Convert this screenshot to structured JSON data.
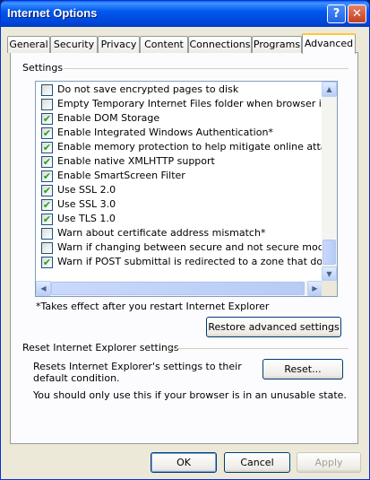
{
  "window": {
    "title": "Internet Options"
  },
  "titlebar_buttons": {
    "help": "?",
    "close": "✕"
  },
  "tabs": [
    {
      "label": "General"
    },
    {
      "label": "Security"
    },
    {
      "label": "Privacy"
    },
    {
      "label": "Content"
    },
    {
      "label": "Connections"
    },
    {
      "label": "Programs"
    },
    {
      "label": "Advanced",
      "active": true
    }
  ],
  "settings_group": {
    "label": "Settings"
  },
  "settings_items": [
    {
      "label": "Do not save encrypted pages to disk",
      "checked": false
    },
    {
      "label": "Empty Temporary Internet Files folder when browser is clo",
      "checked": false
    },
    {
      "label": "Enable DOM Storage",
      "checked": true
    },
    {
      "label": "Enable Integrated Windows Authentication*",
      "checked": true
    },
    {
      "label": "Enable memory protection to help mitigate online attacks*",
      "checked": true
    },
    {
      "label": "Enable native XMLHTTP support",
      "checked": true
    },
    {
      "label": "Enable SmartScreen Filter",
      "checked": true
    },
    {
      "label": "Use SSL 2.0",
      "checked": true
    },
    {
      "label": "Use SSL 3.0",
      "checked": true
    },
    {
      "label": "Use TLS 1.0",
      "checked": true
    },
    {
      "label": "Warn about certificate address mismatch*",
      "checked": false
    },
    {
      "label": "Warn if changing between secure and not secure mode",
      "checked": false
    },
    {
      "label": "Warn if POST submittal is redirected to a zone that does n",
      "checked": true
    }
  ],
  "restart_note": "*Takes effect after you restart Internet Explorer",
  "restore_button": "Restore advanced settings",
  "reset_group": {
    "label": "Reset Internet Explorer settings",
    "description": "Resets Internet Explorer's settings to their default condition.",
    "reset_button": "Reset...",
    "warning": "You should only use this if your browser is in an unusable state."
  },
  "footer": {
    "ok": "OK",
    "cancel": "Cancel",
    "apply": "Apply"
  },
  "check_glyph": "✔"
}
